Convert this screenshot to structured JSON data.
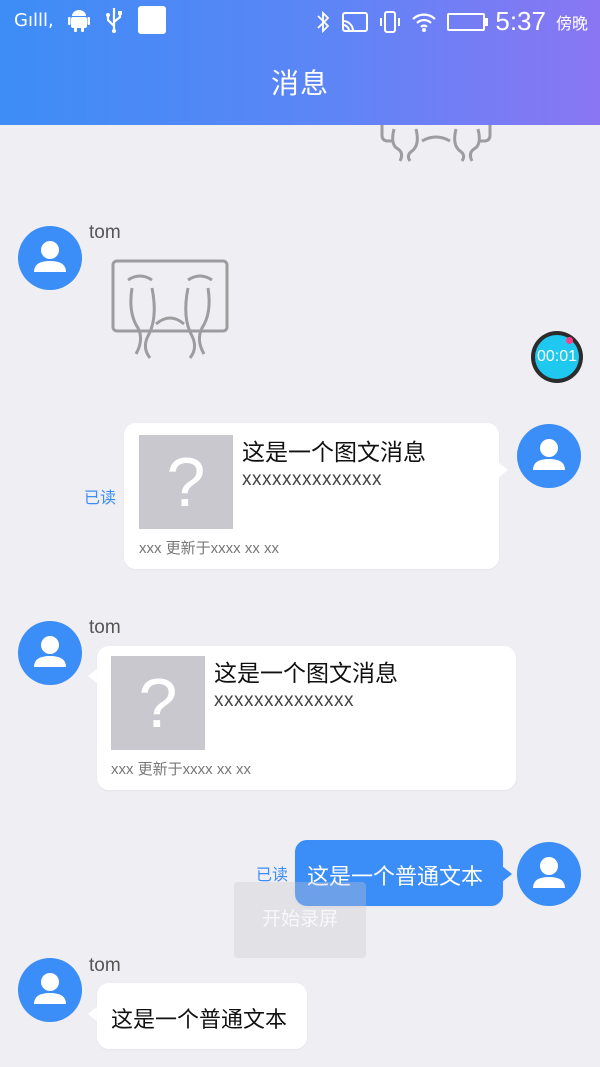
{
  "status_bar": {
    "signal_text": "Gılll,",
    "time": "5:37",
    "period": "傍晚"
  },
  "header": {
    "title": "消息"
  },
  "messages": [
    {
      "type": "sticker",
      "side": "right",
      "partial": true
    },
    {
      "type": "sticker",
      "side": "left",
      "sender": "tom"
    },
    {
      "type": "card",
      "side": "right",
      "read": "已读",
      "title": "这是一个图文消息",
      "subtitle": "xxxxxxxxxxxxxx",
      "thumb": "?",
      "footer": "xxx 更新于xxxx xx xx"
    },
    {
      "type": "card",
      "side": "left",
      "sender": "tom",
      "title": "这是一个图文消息",
      "subtitle": "xxxxxxxxxxxxxx",
      "thumb": "?",
      "footer": "xxx 更新于xxxx xx xx"
    },
    {
      "type": "text",
      "side": "right",
      "read": "已读",
      "text": "这是一个普通文本"
    },
    {
      "type": "text",
      "side": "left",
      "sender": "tom",
      "text": "这是一个普通文本"
    }
  ],
  "overlay": {
    "timer": "00:01",
    "record_button": "开始录屏"
  },
  "colors": {
    "accent": "#3b8df7",
    "background": "#efeef3",
    "header_start": "#3d8df6",
    "header_end": "#8a76f3"
  }
}
